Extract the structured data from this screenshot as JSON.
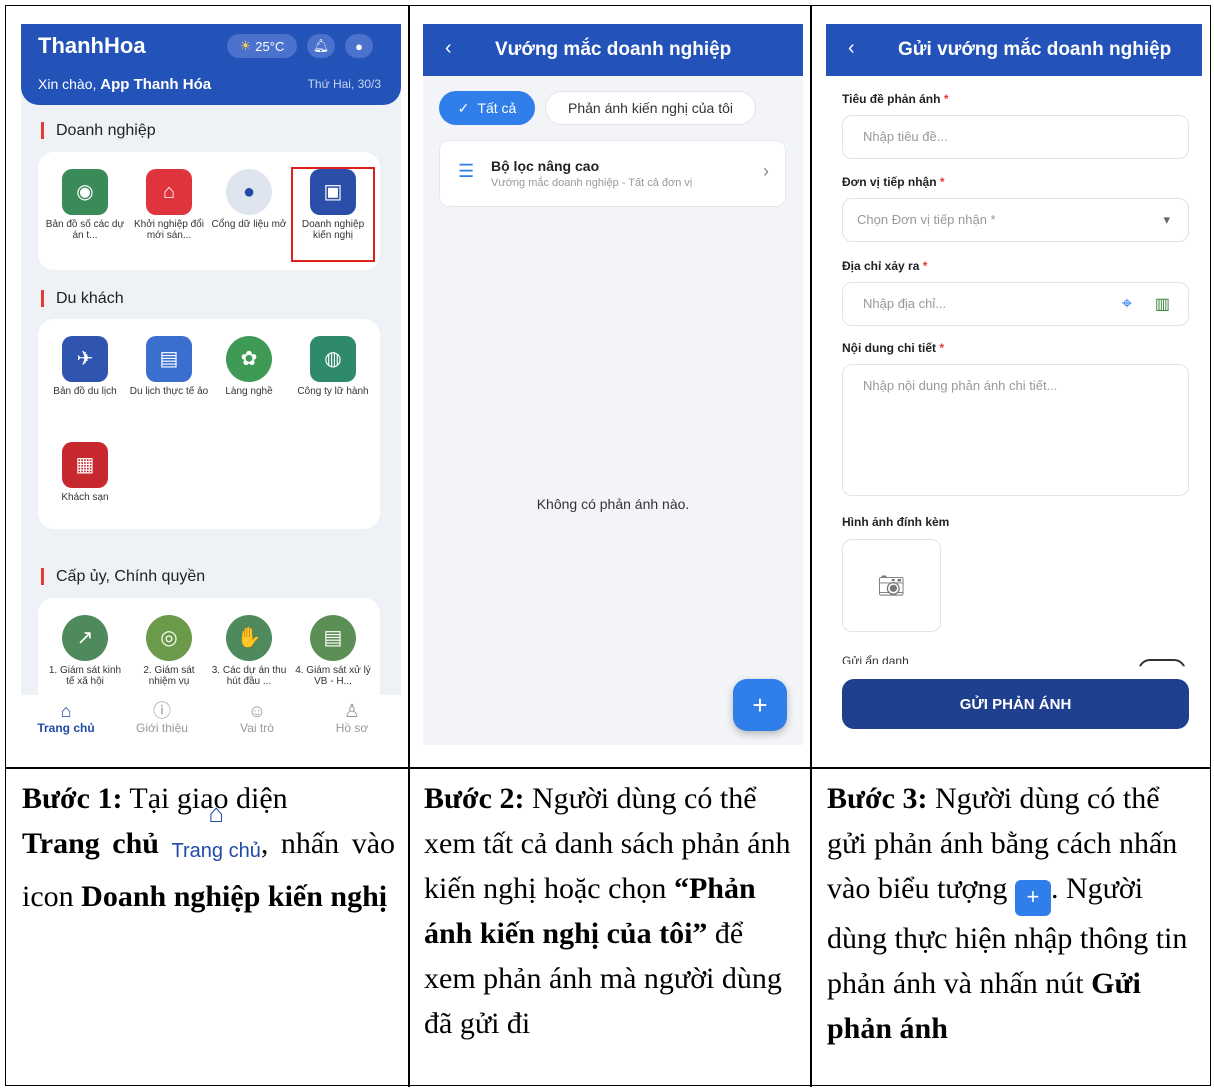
{
  "screen1": {
    "app_title": "ThanhHoa",
    "temp": "25°C",
    "greeting": "Xin chào, ",
    "user": "App Thanh Hóa",
    "date": "Thứ Hai, 30/3",
    "sec_business": "Doanh nghiệp",
    "sec_tourist": "Du khách",
    "sec_gov": "Cấp ủy, Chính quyền",
    "business_tiles": [
      "Bản đồ số các dự án t...",
      "Khởi nghiệp đổi mới sán...",
      "Cổng dữ liệu mở",
      "Doanh nghiệp kiến nghị"
    ],
    "tourist_tiles": [
      "Bản đồ du lịch",
      "Du lịch thực tế ảo",
      "Làng nghề",
      "Công ty lữ hành",
      "Khách sạn"
    ],
    "gov_tiles": [
      "1. Giám sát kinh tế xã hội",
      "2. Giám sát nhiệm vụ",
      "3. Các dự án thu hút đầu ...",
      "4. Giám sát xử lý VB - H..."
    ],
    "tabs": [
      "Trang chủ",
      "Giới thiệu",
      "Vai trò",
      "Hồ sơ"
    ]
  },
  "screen2": {
    "title": "Vướng mắc doanh nghiệp",
    "chip_all": "Tất cả",
    "chip_mine": "Phản ánh kiến nghị của tôi",
    "filter_title": "Bộ lọc nâng cao",
    "filter_sub": "Vướng mắc doanh nghiệp - Tất cả đơn vị",
    "empty": "Không có phản ánh nào.",
    "fab": "+"
  },
  "screen3": {
    "title": "Gửi vướng mắc doanh nghiệp",
    "f1_label": "Tiêu đề phản ánh",
    "f1_ph": "Nhập tiêu đề...",
    "f2_label": "Đơn vị tiếp nhận",
    "f2_ph": "Chọn Đơn vị tiếp nhận *",
    "f3_label": "Địa chỉ xảy ra",
    "f3_ph": "Nhập địa chỉ...",
    "f4_label": "Nội dung chi tiết",
    "f4_ph": "Nhập nội dung phản ánh chi tiết...",
    "f5_label": "Hình ảnh đính kèm",
    "anon": "Gửi ẩn danh",
    "submit": "GỬI PHẢN ÁNH"
  },
  "captions": {
    "c1_b1": "Bước 1:",
    "c1_t1": " Tại giao diện",
    "c1_b2": "Trang chủ",
    "c1_icon": "Trang chủ",
    "c1_t2": ", nhấn vào icon ",
    "c1_b3": "Doanh nghiệp kiến nghị",
    "c2_b1": "Bước 2:",
    "c2_t1": " Người dùng có thể xem tất cả danh sách phản ánh kiến nghị hoặc chọn ",
    "c2_b2": "“Phản ánh kiến nghị của tôi”",
    "c2_t2": " để xem phản ánh mà người dùng đã gửi đi",
    "c3_b1": "Bước 3:",
    "c3_t1": " Người dùng có thể gửi phản ánh bằng cách nhấn vào biểu tượng ",
    "c3_icon": "+",
    "c3_t2": ". Người dùng thực hiện nhập thông tin phản ánh và nhấn nút ",
    "c3_b2": "Gửi phản ánh"
  },
  "colors": {
    "primary": "#2352b8",
    "accent": "#2f7ee9",
    "highlight": "#e0201e"
  }
}
